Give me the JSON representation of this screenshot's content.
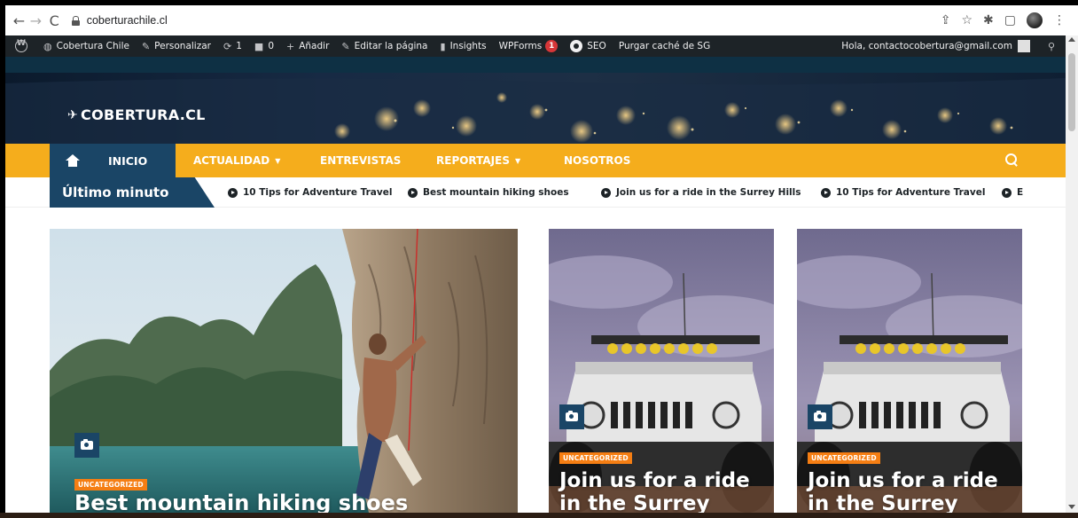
{
  "browser": {
    "url": "coberturachile.cl",
    "back_icon": "←",
    "forward_icon": "→",
    "reload_icon": "C",
    "share_icon": "⇪",
    "star_icon": "☆",
    "extensions_icon": "✱",
    "sidebar_icon": "▢",
    "menu_icon": "⋮"
  },
  "admin_bar": {
    "site_name": "Cobertura Chile",
    "customize": "Personalizar",
    "updates_count": "1",
    "comments_count": "0",
    "add_new": "Añadir",
    "edit_page": "Editar la página",
    "insights": "Insights",
    "wpforms": "WPForms",
    "wpforms_badge": "1",
    "seo": "SEO",
    "purge_cache": "Purgar caché de SG",
    "greeting": "Hola, contactocobertura@gmail.com"
  },
  "site": {
    "logo_text": "COBERTURA.CL"
  },
  "nav": {
    "home_label": "INICIO",
    "items": [
      {
        "label": "ACTUALIDAD",
        "has_caret": true
      },
      {
        "label": "ENTREVISTAS",
        "has_caret": false
      },
      {
        "label": "REPORTAJES",
        "has_caret": true
      },
      {
        "label": "NOSOTROS",
        "has_caret": false
      }
    ]
  },
  "ticker": {
    "label": "Último minuto",
    "items": [
      "10 Tips for Adventure Travel",
      "Best mountain hiking shoes",
      "Join us for a ride in the Surrey Hills",
      "10 Tips for Adventure Travel",
      "E"
    ]
  },
  "cards": [
    {
      "category": "UNCATEGORIZED",
      "title": "Best mountain hiking shoes"
    },
    {
      "category": "UNCATEGORIZED",
      "title": "Join us for a ride in the Surrey"
    },
    {
      "category": "UNCATEGORIZED",
      "title": "Join us for a ride in the Surrey"
    }
  ],
  "colors": {
    "nav_yellow": "#f5ad1c",
    "brand_blue": "#1a4566",
    "category_orange": "#f57e13",
    "admin_bar": "#1d2327"
  }
}
